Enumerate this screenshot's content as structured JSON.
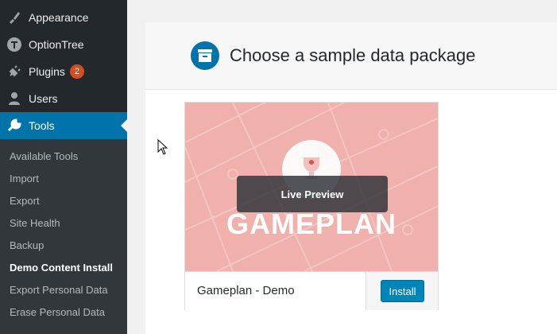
{
  "sidebar": {
    "items": [
      {
        "label": "Appearance",
        "icon": "paintbrush-icon"
      },
      {
        "label": "OptionTree",
        "icon": "optiontree-icon"
      },
      {
        "label": "Plugins",
        "icon": "plugin-icon",
        "badge": "2"
      },
      {
        "label": "Users",
        "icon": "user-icon"
      },
      {
        "label": "Tools",
        "icon": "wrench-icon",
        "active": true
      }
    ],
    "submenu": [
      "Available Tools",
      "Import",
      "Export",
      "Site Health",
      "Backup",
      "Demo Content Install",
      "Export Personal Data",
      "Erase Personal Data"
    ]
  },
  "header": {
    "title": "Choose a sample data package",
    "icon": "archive-box-icon"
  },
  "card": {
    "thumbnail_title": "GAMEPLAN",
    "preview_label": "Live Preview",
    "name": "Gameplan - Demo",
    "install_label": "Install"
  },
  "colors": {
    "accent": "#0073aa",
    "sidebar": "#23282d",
    "thumbnail": "#f0b0ac"
  }
}
